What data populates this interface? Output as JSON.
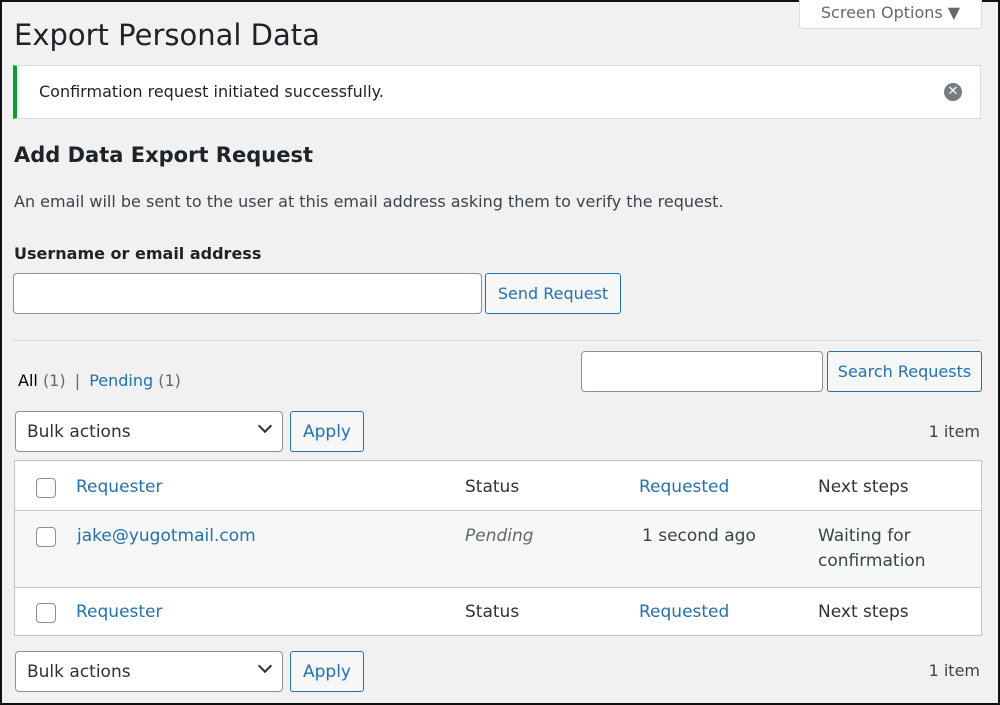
{
  "header": {
    "title": "Export Personal Data",
    "screen_options": "Screen Options ▼"
  },
  "notice": {
    "text": "Confirmation request initiated successfully.",
    "dismiss_icon": "close-circle-icon",
    "accent": "#00a32a"
  },
  "form": {
    "heading": "Add Data Export Request",
    "description": "An email will be sent to the user at this email address asking them to verify the request.",
    "label": "Username or email address",
    "value": "",
    "submit": "Send Request"
  },
  "filters": {
    "all": "All",
    "all_count": "(1)",
    "separator": "|",
    "pending": "Pending",
    "pending_count": "(1)"
  },
  "search": {
    "value": "",
    "button": "Search Requests"
  },
  "bulk": {
    "selected": "Bulk actions",
    "apply": "Apply",
    "count": "1 item"
  },
  "table": {
    "columns": [
      "Requester",
      "Status",
      "Requested",
      "Next steps"
    ],
    "rows": [
      {
        "requester": "jake@yugotmail.com",
        "status": "Pending",
        "requested": "1 second ago",
        "next_steps_line1": "Waiting for",
        "next_steps_line2": "confirmation"
      }
    ]
  }
}
